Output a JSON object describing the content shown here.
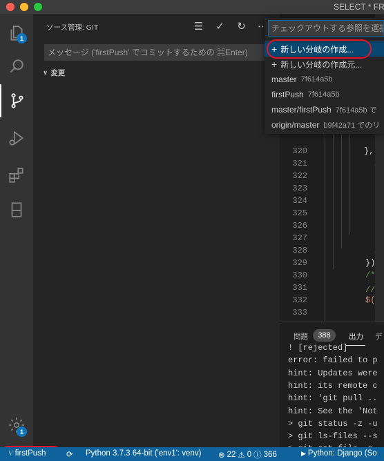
{
  "window": {
    "title": "SELECT * FRO"
  },
  "activity_bar": {
    "explorer_badge": "1",
    "settings_badge": "1"
  },
  "sidebar": {
    "title": "ソース管理: GIT",
    "commit_placeholder": "メッセージ ('firstPush' でコミットするための ⌘Enter)",
    "changes_label": "変更"
  },
  "quick_pick": {
    "placeholder": "チェックアウトする参照を選択",
    "items": [
      {
        "label": "新しい分岐の作成...",
        "desc": ""
      },
      {
        "label": "新しい分岐の作成元...",
        "desc": ""
      },
      {
        "label": "master",
        "desc": "7f614a5b"
      },
      {
        "label": "firstPush",
        "desc": "7f614a5b"
      },
      {
        "label": "master/firstPush",
        "desc": "7f614a5b で"
      },
      {
        "label": "origin/master",
        "desc": "b9f42a71 でのリ"
      }
    ]
  },
  "editor": {
    "line_numbers": [
      "320",
      "321",
      "322",
      "323",
      "324",
      "325",
      "326",
      "327",
      "328",
      "329",
      "330",
      "331",
      "332",
      "333",
      "334",
      "335"
    ],
    "code": [
      {
        "text": "},",
        "color": "#d4d4d4"
      },
      {
        "text": ".d",
        "color": "#dcdcaa"
      },
      {
        "text": "",
        "color": "#d4d4d4"
      },
      {
        "text": "",
        "color": "#d4d4d4"
      },
      {
        "text": "",
        "color": "#d4d4d4"
      },
      {
        "text": "",
        "color": "#d4d4d4"
      },
      {
        "text": "",
        "color": "#d4d4d4"
      },
      {
        "text": "})",
        "color": "#d4d4d4"
      },
      {
        "text": ".f",
        "color": "#dcdcaa"
      },
      {
        "text": "})",
        "color": "#d4d4d4"
      },
      {
        "text": "/*",
        "color": "#6a9955"
      },
      {
        "text": "//ー",
        "color": "#6a9955"
      },
      {
        "text": "$('b",
        "color": "#ce9178"
      },
      {
        "text": "",
        "color": "#d4d4d4"
      },
      {
        "text": "//",
        "color": "#6a9955"
      },
      {
        "text": "",
        "color": "#d4d4d4"
      }
    ]
  },
  "panel": {
    "tab_problems": "問題",
    "problems_count": "388",
    "tab_output": "出力",
    "tab_debug": "デ",
    "output_lines": [
      "! [rejected]",
      "error: failed to p",
      "hint: Updates were",
      "hint: its remote c",
      "hint: 'git pull ..",
      "hint: See the 'Not",
      "> git status -z -u",
      "> git ls-files --s",
      "> git cat-file -s"
    ]
  },
  "status_bar": {
    "branch": "firstPush",
    "python": "Python 3.7.3 64-bit ('env1': venv)",
    "errors": "22",
    "warnings": "0",
    "info": "366",
    "interpreter": "Python: Django (So"
  },
  "colors": {
    "accent": "#0e639c",
    "selection": "#094771",
    "annotation": "#e2142d"
  }
}
